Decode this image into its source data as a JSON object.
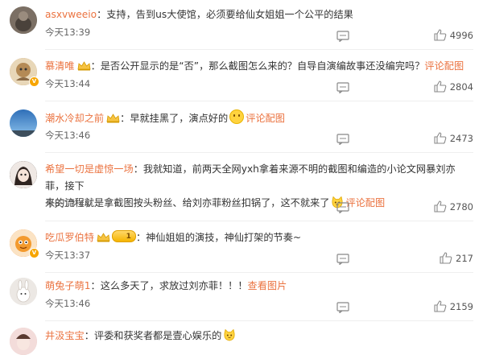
{
  "comments": [
    {
      "user": "asxvweeio",
      "text": "支持，告到us大使馆，必须要给仙女姐姐一个公平的结果",
      "time": "今天13:39",
      "likes": "4996",
      "avatar_color": "#6b6055"
    },
    {
      "user": "慕清唯",
      "text": "是否公开显示的是“否”，那么截图怎么来的？自导自演编故事还没编完吗？",
      "link": "评论配图",
      "time": "今天13:44",
      "likes": "2804",
      "avatar_color": "#c9a06b"
    },
    {
      "user": "潮水冷却之前",
      "text": "早就挂黑了，演点好的",
      "link": "评论配图",
      "time": "今天13:46",
      "likes": "2473",
      "avatar_color": "#3f86c9"
    },
    {
      "user": "希望一切是虚惊一场",
      "text_line1": "我就知道，前两天全网yxh拿着来源不明的截图和编造的小论文网暴刘亦菲，接下",
      "text_line2": "来的流程就是拿截图按头粉丝、给刘亦菲粉丝扣锅了，这不就来了",
      "link": "评论配图",
      "time": "今天13:44",
      "likes": "2780",
      "avatar_color": "#4a3b36"
    },
    {
      "user": "吃瓜罗伯特",
      "level": "1",
      "text": "神仙姐姐的演技，神仙打架的节奏~",
      "time": "今天13:37",
      "likes": "217",
      "avatar_color": "#f08a2a"
    },
    {
      "user": "萌兔子萌1",
      "text": "这么多天了，求放过刘亦菲！！！",
      "link": "查看图片",
      "time": "今天13:46",
      "likes": "2159",
      "avatar_color": "#d8d2cc"
    },
    {
      "user": "井汲宝宝",
      "text": "评委和获奖者都是壹心娱乐的",
      "avatar_color": "#e6c3c0"
    }
  ],
  "colors": {
    "username": "#eb7340",
    "text": "#333333",
    "meta": "#666666"
  }
}
